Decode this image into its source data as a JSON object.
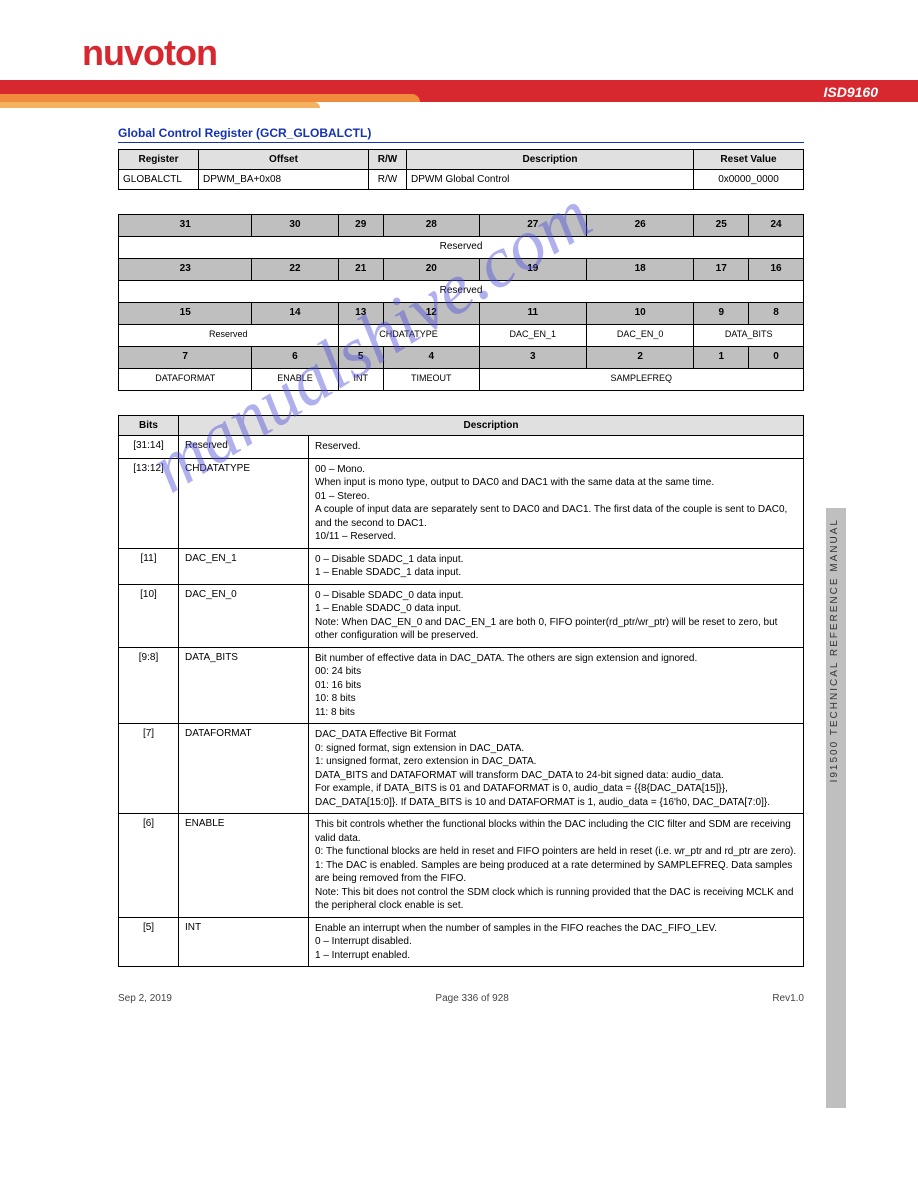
{
  "header": {
    "logo_text": "nuvoTon",
    "chip_title": "ISD9160"
  },
  "register": {
    "title": "Global Control Register (GCR_GLOBALCTL)",
    "overview_headers": [
      "Register",
      "Offset",
      "R/W",
      "Description",
      "Reset Value"
    ],
    "overview_values": [
      "GLOBALCTL",
      "DPWM_BA+0x08",
      "R/W",
      "DPWM Global Control",
      "0x0000_0000"
    ]
  },
  "bitmap": {
    "rows": [
      {
        "nums": [
          "31",
          "30",
          "29",
          "28",
          "27",
          "26",
          "25",
          "24"
        ],
        "span": {
          "text": "Reserved",
          "colspan": 8
        }
      },
      {
        "nums": [
          "23",
          "22",
          "21",
          "20",
          "19",
          "18",
          "17",
          "16"
        ],
        "span": {
          "text": "Reserved",
          "colspan": 8
        }
      },
      {
        "nums": [
          "15",
          "14",
          "13",
          "12",
          "11",
          "10",
          "9",
          "8"
        ],
        "cells": [
          {
            "text": "Reserved",
            "colspan": 2
          },
          {
            "text": "CHDATATYPE",
            "colspan": 2
          },
          {
            "text": "DAC_EN_1",
            "colspan": 1
          },
          {
            "text": "DAC_EN_0",
            "colspan": 1
          },
          {
            "text": "DATA_BITS",
            "colspan": 2
          }
        ]
      },
      {
        "nums": [
          "7",
          "6",
          "5",
          "4",
          "3",
          "2",
          "1",
          "0"
        ],
        "cells": [
          {
            "text": "DATAFORMAT",
            "colspan": 1
          },
          {
            "text": "ENABLE",
            "colspan": 1
          },
          {
            "text": "INT",
            "colspan": 1
          },
          {
            "text": "TIMEOUT",
            "colspan": 1
          },
          {
            "text": "SAMPLEFREQ",
            "colspan": 4
          }
        ]
      }
    ]
  },
  "desc": {
    "headers": [
      "Bits",
      "Description"
    ],
    "rows": [
      {
        "bits": "[31:14]",
        "name": "Reserved",
        "desc": "Reserved."
      },
      {
        "bits": "[13:12]",
        "name": "CHDATATYPE",
        "desc": "00 – Mono.\n         When input is mono type, output to DAC0 and DAC1 with the same data at the same time.\n01 – Stereo.\n         A couple of input data are separately sent to DAC0 and DAC1. The first data of the couple is sent to DAC0, and the second to DAC1.\n10/11 – Reserved."
      },
      {
        "bits": "[11]",
        "name": "DAC_EN_1",
        "desc": "0 – Disable SDADC_1 data input.\n1 – Enable SDADC_1 data input."
      },
      {
        "bits": "[10]",
        "name": "DAC_EN_0",
        "desc": "0 – Disable SDADC_0 data input.\n1 – Enable SDADC_0 data input.\nNote: When DAC_EN_0 and DAC_EN_1 are both 0, FIFO pointer(rd_ptr/wr_ptr) will be reset to zero, but other configuration will be preserved."
      },
      {
        "bits": "[9:8]",
        "name": "DATA_BITS",
        "desc": "Bit number of effective data in DAC_DATA. The others are sign extension and ignored.\n00: 24 bits\n01: 16 bits\n10: 8 bits\n11: 8 bits"
      },
      {
        "bits": "[7]",
        "name": "DATAFORMAT",
        "desc": "DAC_DATA Effective Bit Format\n0: signed format, sign extension in DAC_DATA.\n1: unsigned format, zero extension in DAC_DATA.\nDATA_BITS and DATAFORMAT will transform DAC_DATA to 24-bit signed data: audio_data.\nFor example, if DATA_BITS is 01 and DATAFORMAT is 0, audio_data = {{8{DAC_DATA[15]}}, DAC_DATA[15:0]}. If DATA_BITS is 10 and DATAFORMAT is 1, audio_data = {16'h0, DAC_DATA[7:0]}."
      },
      {
        "bits": "[6]",
        "name": "ENABLE",
        "desc": "This bit controls whether the functional blocks within the DAC including the CIC filter and SDM are receiving valid data.\n0: The functional blocks are held in reset and FIFO pointers are held in reset (i.e. wr_ptr and rd_ptr are zero).\n1: The DAC is enabled. Samples are being produced at a rate determined by SAMPLEFREQ. Data samples are being removed from the FIFO.\nNote: This bit does not control the SDM clock which is running provided that the DAC is receiving MCLK and the peripheral clock enable is set."
      },
      {
        "bits": "[5]",
        "name": "INT",
        "desc": "Enable an interrupt when the number of samples in the FIFO reaches the DAC_FIFO_LEV.\n0 – Interrupt disabled.\n1 – Interrupt enabled."
      }
    ]
  },
  "sidebar": {
    "text": "I91500 TECHNICAL REFERENCE MANUAL"
  },
  "footer": {
    "left": "Sep 2, 2019",
    "center": "Page 336 of 928",
    "right": "Rev1.0"
  },
  "watermark": "manualshive.com"
}
